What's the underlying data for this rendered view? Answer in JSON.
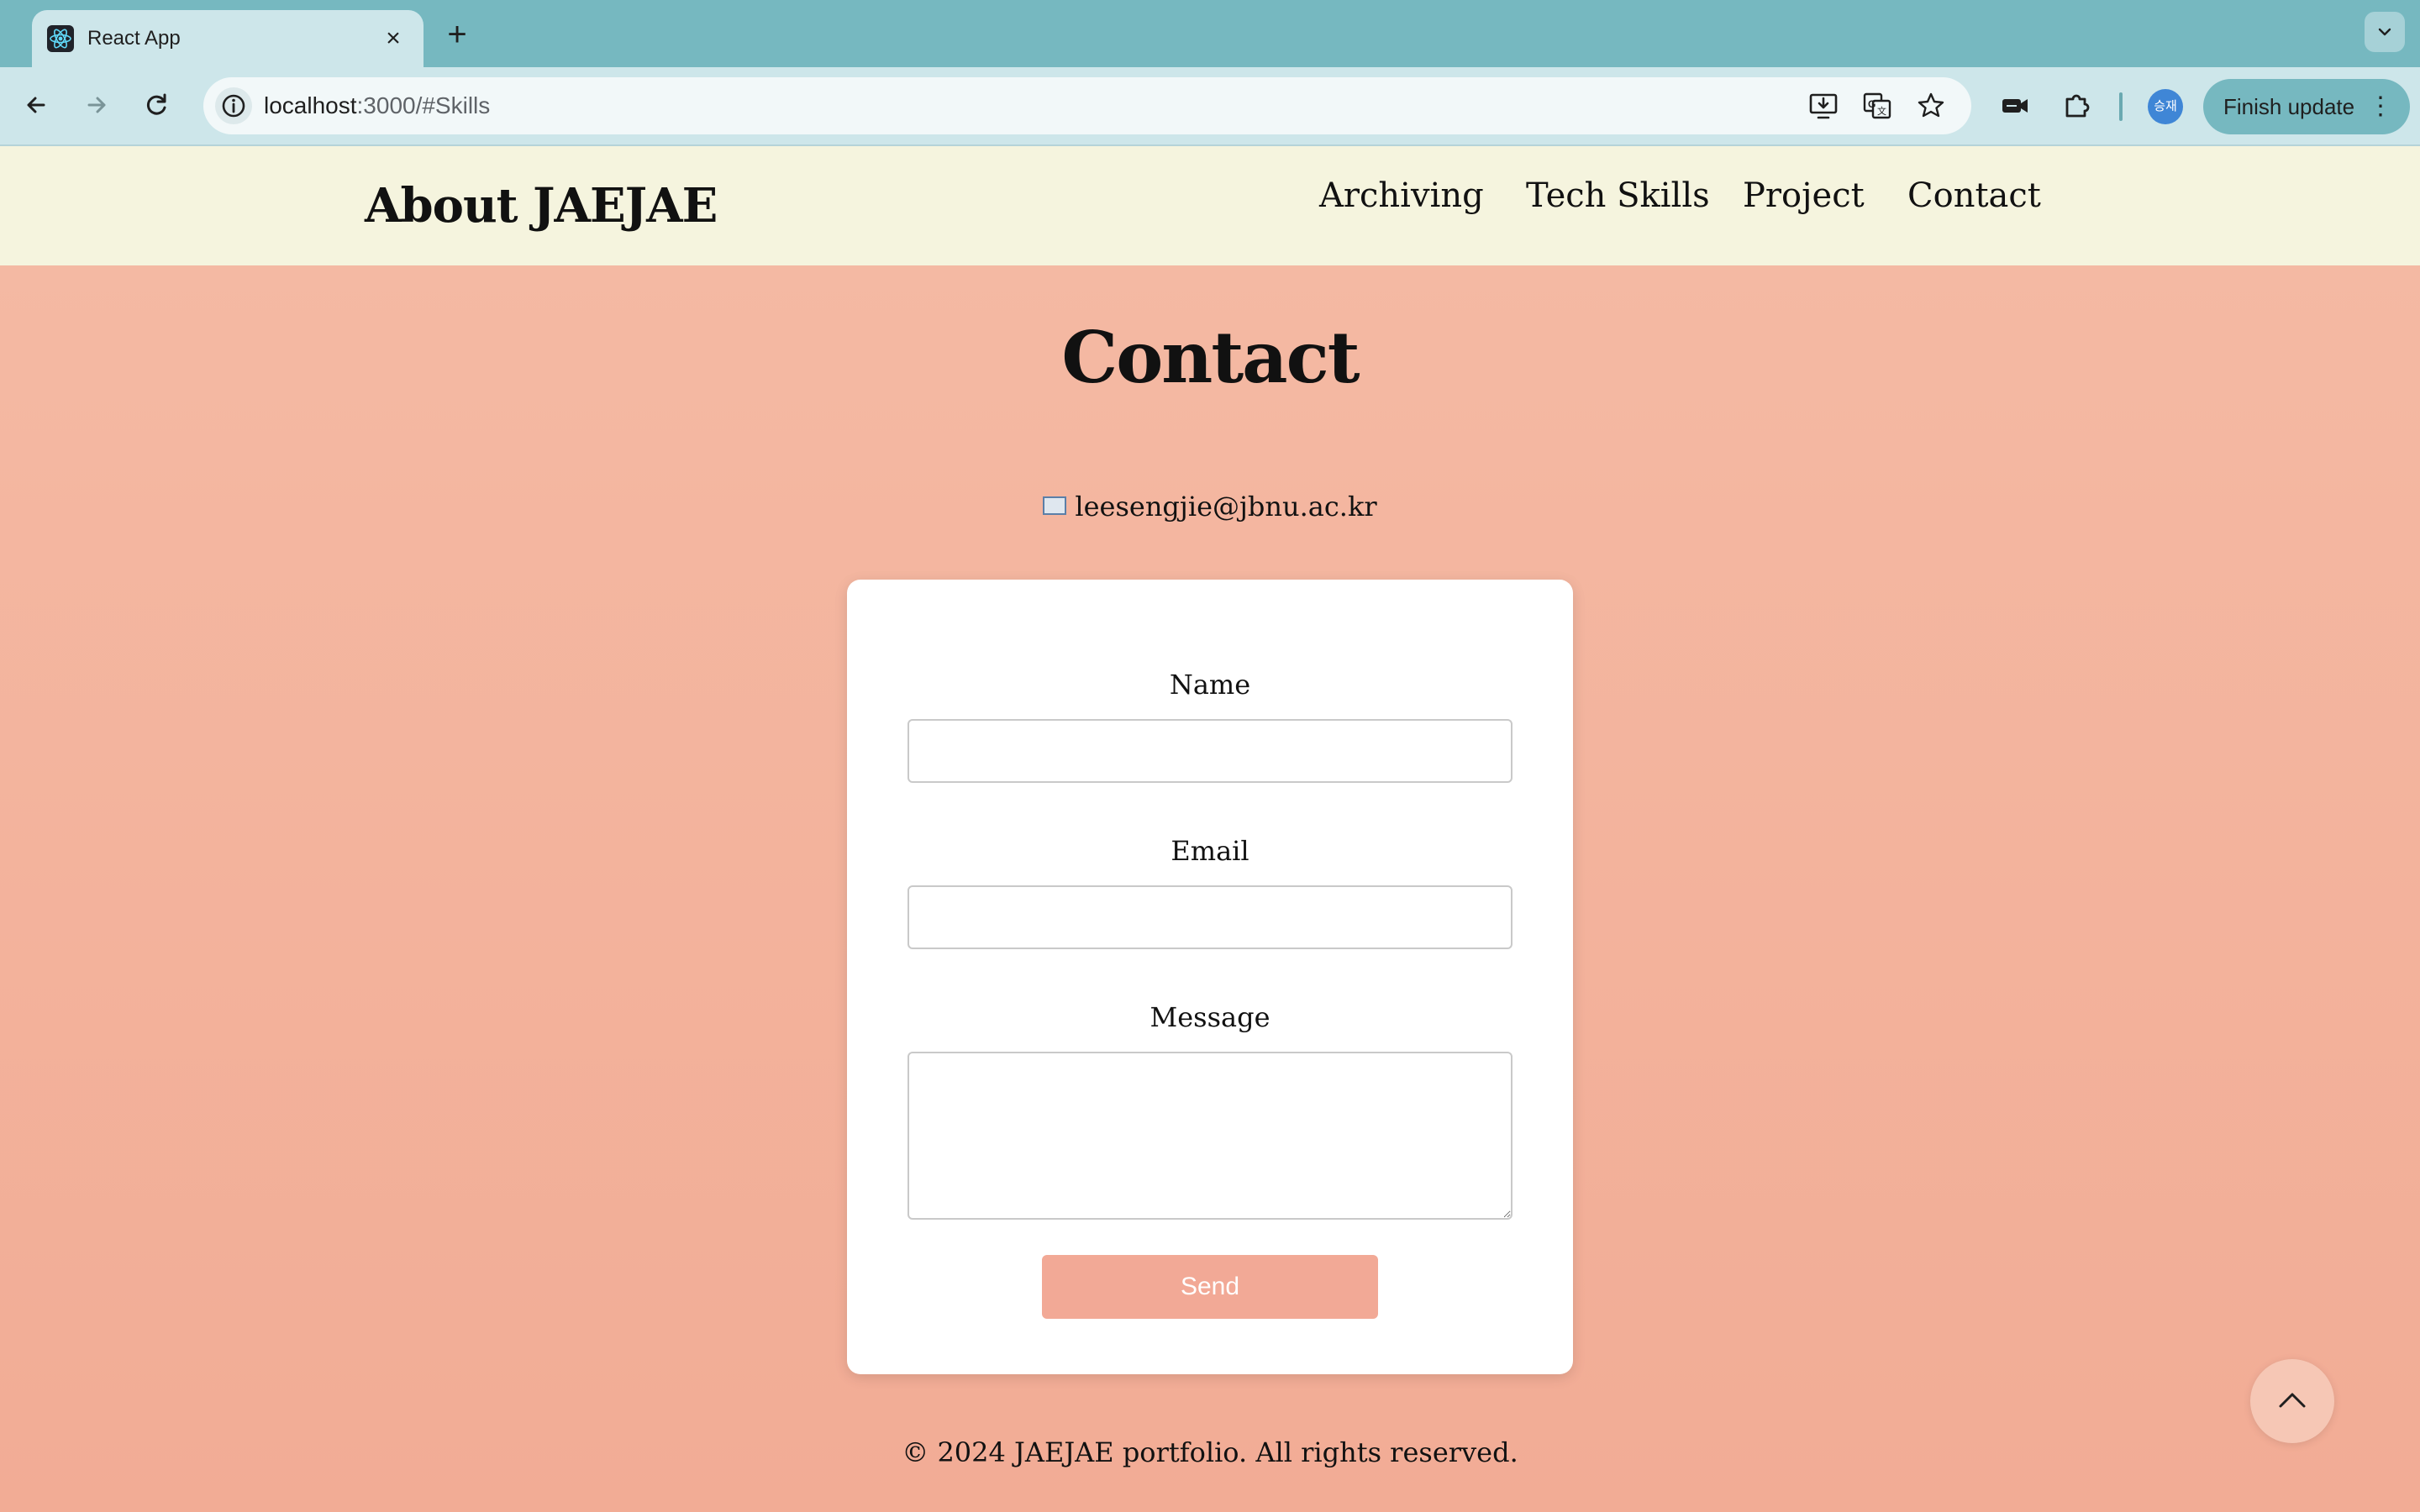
{
  "browser": {
    "tab_title": "React App",
    "tab_close": "×",
    "new_tab": "+",
    "url_host": "localhost",
    "url_rest": ":3000/#Skills",
    "avatar_text": "승재",
    "finish_update_label": "Finish update",
    "finish_update_menu": "⋮"
  },
  "site": {
    "logo": "About JAEJAE",
    "nav": [
      "Archiving",
      "Tech Skills",
      "Project",
      "Contact"
    ]
  },
  "contact": {
    "title": "Contact",
    "email": "leesengjie@jbnu.ac.kr",
    "form": {
      "name_label": "Name",
      "name_value": "",
      "email_label": "Email",
      "email_value": "",
      "message_label": "Message",
      "message_value": "",
      "send_label": "Send"
    }
  },
  "footer": {
    "text": "© 2024 JAEJAE portfolio. All rights reserved."
  },
  "colors": {
    "tabstrip": "#76b8c0",
    "toolbar": "#cde6ea",
    "header_bg": "#f5f4de",
    "page_bg": "#f3b29c",
    "send_button": "#f2a996"
  },
  "icons": [
    "react-favicon-icon",
    "back-arrow-icon",
    "forward-arrow-icon",
    "reload-icon",
    "site-info-icon",
    "install-app-icon",
    "translate-icon",
    "bookmark-star-icon",
    "video-camera-icon",
    "extensions-puzzle-icon",
    "mail-icon",
    "chevron-up-icon",
    "chevron-down-icon"
  ]
}
